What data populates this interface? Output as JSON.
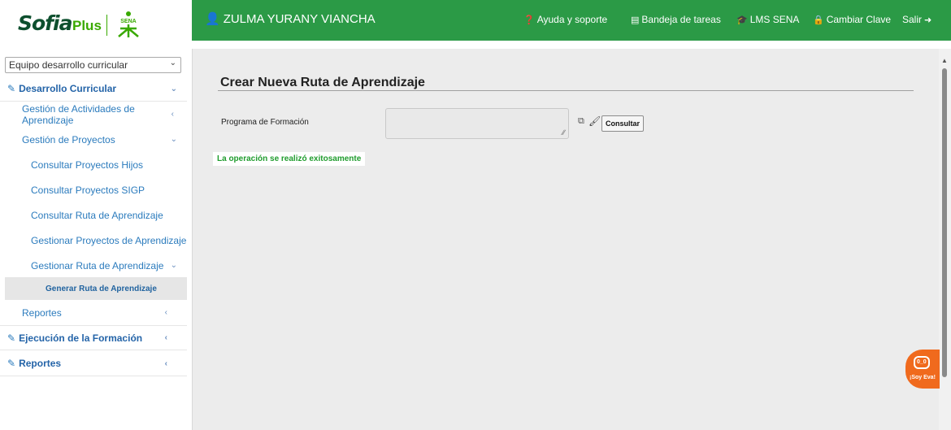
{
  "brand": {
    "logo_sofia": "Sofia",
    "logo_plus": "Plus",
    "sena_text": "SENA",
    "green": "#39a900",
    "header_green": "#2b9a46"
  },
  "header": {
    "user_name": "ZULMA YURANY VIANCHA",
    "user_icon": "user-icon",
    "links": [
      {
        "label": "Ayuda y soporte",
        "icon": "question-circle-icon"
      },
      {
        "label": "Bandeja de tareas",
        "icon": "tasks-icon"
      },
      {
        "label": "LMS SENA",
        "icon": "graduation-cap-icon"
      },
      {
        "label": "Cambiar Clave",
        "icon": "lock-icon"
      },
      {
        "label": "Salir",
        "icon": "sign-out-icon"
      }
    ]
  },
  "sidebar": {
    "role_select": "Equipo desarrollo curricular",
    "items": [
      {
        "label": "Desarrollo Curricular"
      },
      {
        "label": "Gestión de Actividades de Aprendizaje"
      },
      {
        "label": "Gestión de Proyectos"
      },
      {
        "label": "Consultar Proyectos Hijos"
      },
      {
        "label": "Consultar Proyectos SIGP"
      },
      {
        "label": "Consultar Ruta de Aprendizaje"
      },
      {
        "label": "Gestionar Proyectos de Aprendizaje"
      },
      {
        "label": "Gestionar Ruta de Aprendizaje"
      },
      {
        "label": "Generar Ruta de Aprendizaje"
      },
      {
        "label": "Reportes"
      },
      {
        "label": "Ejecución de la Formación"
      },
      {
        "label": "Reportes"
      }
    ]
  },
  "main": {
    "title": "Crear Nueva Ruta de Aprendizaje",
    "field_label": "Programa de Formación",
    "field_value": "",
    "consult_button": "Consultar",
    "success_message": "La operación se realizó exitosamente"
  },
  "assistant": {
    "label": "¡Soy Eva!",
    "eyes": "0_0",
    "color": "#f06a1d"
  }
}
